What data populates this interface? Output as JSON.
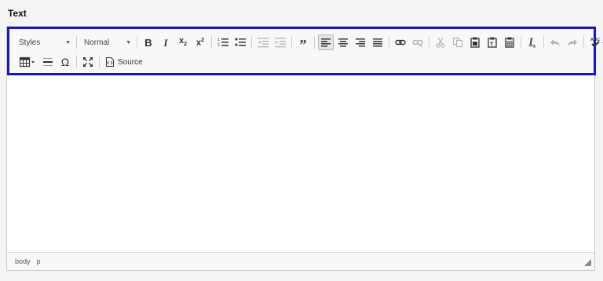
{
  "field": {
    "label": "Text"
  },
  "toolbar": {
    "styles_combo": {
      "value": "Styles"
    },
    "format_combo": {
      "value": "Normal"
    },
    "source_label": "Source"
  },
  "statusbar": {
    "path": [
      "body",
      "p"
    ]
  },
  "colors": {
    "highlight_border": "#1414d2",
    "toolbar_bg": "#f8f8f8"
  }
}
